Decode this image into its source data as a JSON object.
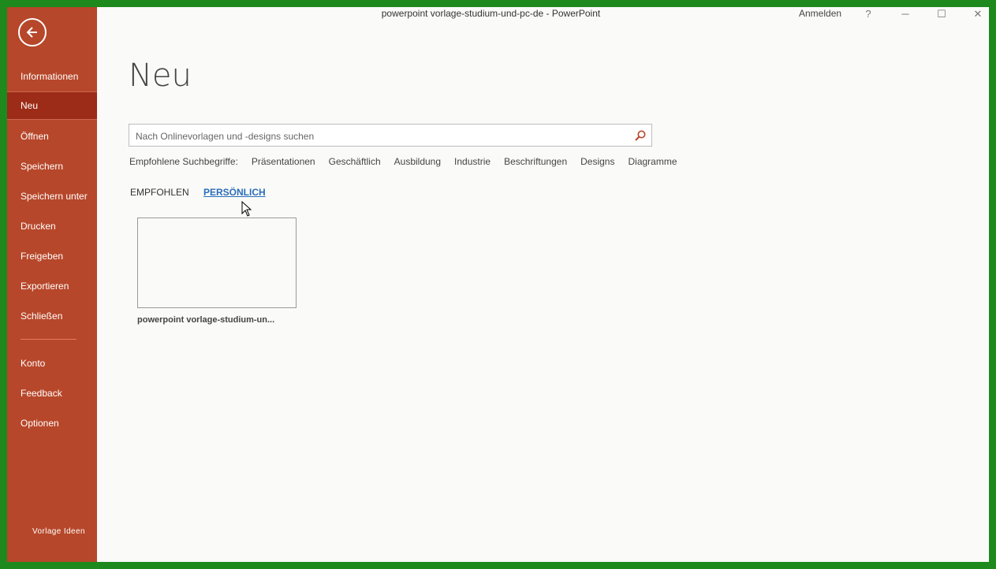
{
  "window": {
    "title": "powerpoint vorlage-studium-und-pc-de  -  PowerPoint",
    "signin": "Anmelden",
    "help": "?",
    "minimize": "─",
    "maximize": "☐",
    "close": "✕"
  },
  "sidebar": {
    "items": [
      {
        "label": "Informationen"
      },
      {
        "label": "Neu"
      },
      {
        "label": "Öffnen"
      },
      {
        "label": "Speichern"
      },
      {
        "label": "Speichern unter"
      },
      {
        "label": "Drucken"
      },
      {
        "label": "Freigeben"
      },
      {
        "label": "Exportieren"
      },
      {
        "label": "Schließen"
      },
      {
        "label": "Konto"
      },
      {
        "label": "Feedback"
      },
      {
        "label": "Optionen"
      }
    ],
    "active": "Neu",
    "footer": "Vorlage Ideen"
  },
  "main": {
    "heading": "Neu",
    "search": {
      "placeholder": "Nach Onlinevorlagen und -designs suchen"
    },
    "suggested": {
      "label": "Empfohlene Suchbegriffe:",
      "terms": [
        "Präsentationen",
        "Geschäftlich",
        "Ausbildung",
        "Industrie",
        "Beschriftungen",
        "Designs",
        "Diagramme"
      ]
    },
    "tabs": {
      "featured": "EMPFOHLEN",
      "personal": "PERSÖNLICH"
    },
    "templates": [
      {
        "name": "powerpoint vorlage-studium-un..."
      }
    ]
  },
  "colors": {
    "sidebar": "#b7472a",
    "sidebar_active": "#9c2b17",
    "link": "#2a6ebb",
    "frame": "#1e8a1e"
  }
}
